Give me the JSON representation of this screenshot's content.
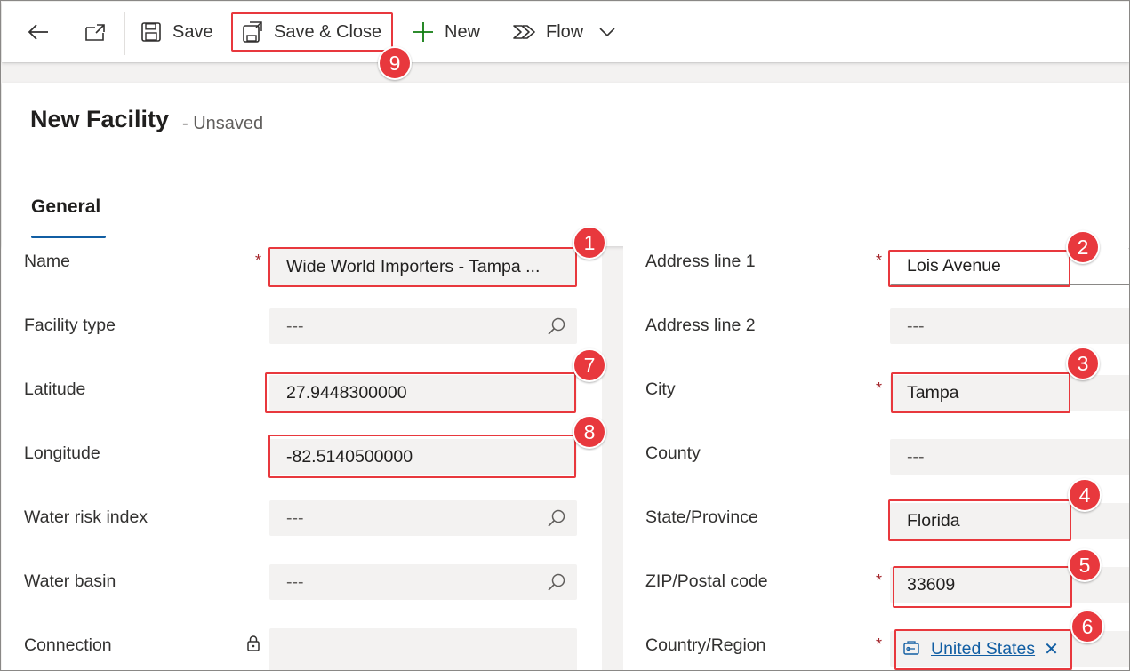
{
  "toolbar": {
    "save_label": "Save",
    "save_close_label": "Save & Close",
    "new_label": "New",
    "flow_label": "Flow"
  },
  "header": {
    "title": "New Facility",
    "subtitle": "- Unsaved",
    "tab_general": "General"
  },
  "form_left": {
    "name_label": "Name",
    "name_value": "Wide World Importers - Tampa ...",
    "facility_type_label": "Facility type",
    "facility_type_value": "---",
    "latitude_label": "Latitude",
    "latitude_value": "27.9448300000",
    "longitude_label": "Longitude",
    "longitude_value": "-82.5140500000",
    "water_risk_label": "Water risk index",
    "water_risk_value": "---",
    "water_basin_label": "Water basin",
    "water_basin_value": "---",
    "connection_label": "Connection"
  },
  "form_right": {
    "address1_label": "Address line 1",
    "address1_value": "Lois Avenue",
    "address2_label": "Address line 2",
    "address2_value": "---",
    "city_label": "City",
    "city_value": "Tampa",
    "county_label": "County",
    "county_value": "---",
    "state_label": "State/Province",
    "state_value": "Florida",
    "zip_label": "ZIP/Postal code",
    "zip_value": "33609",
    "country_label": "Country/Region",
    "country_value": "United States"
  },
  "required_mark": "*",
  "annotations": {
    "b1": "1",
    "b2": "2",
    "b3": "3",
    "b4": "4",
    "b5": "5",
    "b6": "6",
    "b7": "7",
    "b8": "8",
    "b9": "9"
  },
  "colors": {
    "annotation": "#e8383d",
    "accent": "#115ea3",
    "required": "#a4262c",
    "new_plus": "#107c10"
  }
}
